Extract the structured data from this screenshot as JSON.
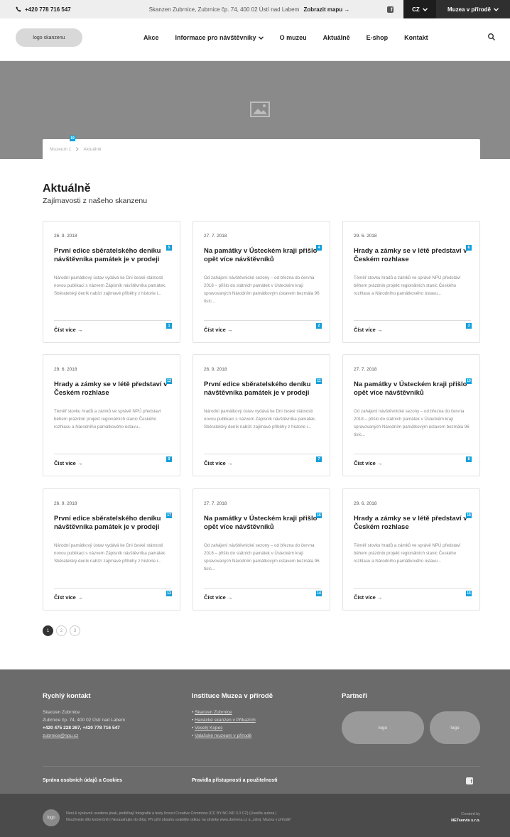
{
  "topbar": {
    "phone": "+420 778 716 547",
    "address": "Skanzen Zubrnice, Zubrnice čp. 74, 400 02 Ústí nad Labem",
    "map_link": "Zobrazit mapu →",
    "language": "CZ",
    "museums": "Muzea v přírodě"
  },
  "nav": {
    "logo": "logo skanzenu",
    "items": [
      "Akce",
      "Informace pro návštěvníky",
      "O muzeu",
      "Aktuálně",
      "E-shop",
      "Kontakt"
    ]
  },
  "breadcrumb": {
    "items": [
      "Muzeum 1",
      "Aktuálně"
    ],
    "badge": "19"
  },
  "page": {
    "title": "Aktuálně",
    "subtitle": "Zajímavosti z našeho skanzenu"
  },
  "cards": [
    {
      "date": "26. 9. 2018",
      "title": "První edice sběratelského deníku návštěvníka památek je v prodeji",
      "text": "Národní památkový ústav vydává ke Dni české státnosti novou publikaci s názvem Zápisník návštěvníka památek. Sběratelský deník nabízí zajímavé příběhy z historie i...",
      "more": "Číst více →",
      "title_badge": "5",
      "more_badge": "1"
    },
    {
      "date": "27. 7. 2018",
      "title": "Na památky v Ústeckém kraji přišlo opět více návštěvníků",
      "text": "Od zahájení návštěvnické sezony – od března do června 2018 – přišlo do státních památek v Ústeckém kraji spravovaných Národním památkovým ústavem bezmála 96 tisíc...",
      "more": "Číst více →",
      "title_badge": "4",
      "more_badge": "2"
    },
    {
      "date": "29. 6. 2018",
      "title": "Hrady a zámky se v létě představí v Českém rozhlase",
      "text": "Téměř stovku hradů a zámků ve správě NPÚ představí během prázdnin projekt regionálních stanic Českého rozhlasu a Národního památkového ústavu...",
      "more": "Číst více →",
      "title_badge": "6",
      "more_badge": "3"
    },
    {
      "date": "29. 6. 2018",
      "title": "Hrady a zámky se v létě představí v Českém rozhlase",
      "text": "Téměř stovku hradů a zámků ve správě NPÚ představí během prázdnin projekt regionálních stanic Českého rozhlasu a Národního památkového ústavu...",
      "more": "Číst více →",
      "title_badge": "12",
      "more_badge": "9"
    },
    {
      "date": "26. 9. 2018",
      "title": "První edice sběratelského deníku návštěvníka památek je v prodeji",
      "text": "Národní památkový ústav vydává ke Dni české státnosti novou publikaci s názvem Zápisník návštěvníka památek. Sběratelský deník nabízí zajímavé příběhy z historie i...",
      "more": "Číst více →",
      "title_badge": "11",
      "more_badge": "7"
    },
    {
      "date": "27. 7. 2018",
      "title": "Na památky v Ústeckém kraji přišlo opět více návštěvníků",
      "text": "Od zahájení návštěvnické sezony – od března do června 2018 – přišlo do státních památek v Ústeckém kraji spravovaných Národním památkovým ústavem bezmála 96 tisíc...",
      "more": "Číst více →",
      "title_badge": "10",
      "more_badge": "8"
    },
    {
      "date": "26. 9. 2018",
      "title": "První edice sběratelského deníku návštěvníka památek je v prodeji",
      "text": "Národní památkový ústav vydává ke Dni české státnosti novou publikaci s názvem Zápisník návštěvníka památek. Sběratelský deník nabízí zajímavé příběhy z historie i...",
      "more": "Číst více →",
      "title_badge": "17",
      "more_badge": "13"
    },
    {
      "date": "27. 7. 2018",
      "title": "Na památky v Ústeckém kraji přišlo opět více návštěvníků",
      "text": "Od zahájení návštěvnické sezony – od března do června 2018 – přišlo do státních památek v Ústeckém kraji spravovaných Národním památkovým ústavem bezmála 96 tisíc...",
      "more": "Číst více →",
      "title_badge": "16",
      "more_badge": "14"
    },
    {
      "date": "29. 6. 2018",
      "title": "Hrady a zámky se v létě představí v Českém rozhlase",
      "text": "Téměř stovku hradů a zámků ve správě NPÚ představí během prázdnin projekt regionálních stanic Českého rozhlasu a Národního památkového ústavu...",
      "more": "Číst více →",
      "title_badge": "18",
      "more_badge": "15"
    }
  ],
  "pagination": [
    "1",
    "2",
    "3"
  ],
  "footer": {
    "contact": {
      "heading": "Rychlý kontakt",
      "line1": "Skanzen Zubrnice",
      "line2": "Zubrnice čp. 74, 400 02 Ústí nad Labem",
      "phones": "+420 475 228 267, +420 778 716 547",
      "email": "zubrnice@npu.cz"
    },
    "institutions": {
      "heading": "Instituce Muzea v přírodě",
      "items": [
        "Skanzen Zubrnice",
        "Hanácké skanzen v Příkazích",
        "Veselý Kopec",
        "Valašské muzeum v přírodě"
      ]
    },
    "partners": {
      "heading": "Partneři",
      "logos": [
        "logo",
        "logo"
      ]
    },
    "privacy": "Správa osobních údajů a Cookies",
    "accessibility": "Pravidla přístupnosti a použitelnosti",
    "logo": "logo",
    "license_line1": "Není-li výslovně uvedeno jinak, podléhají fotografie a texty licenci Creative Commons (CC BY-NC-ND 3.0 CZ) (Uveďte autora |",
    "license_line2": "Neužívejte dílo komerčně | Nezasahujte do díla). Při užití obsahu uvádějte odkaz na stránky www.domena.cz a „zdroj: Muzea v přírodě“",
    "created_by": "Created by",
    "creator": "NETservis s.r.o."
  },
  "colors": {
    "accent": "#1a9fd8",
    "hero": "#8a8a8a",
    "footer": "#6b6b6b",
    "footer_bottom": "#4b4b4b"
  }
}
